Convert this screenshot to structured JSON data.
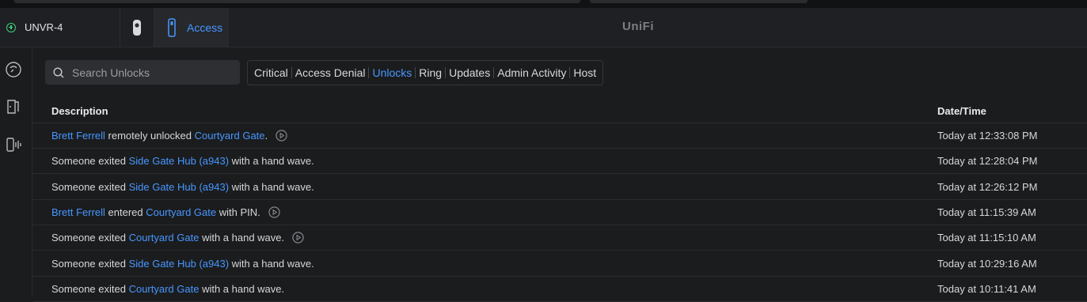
{
  "header": {
    "console_name": "UNVR-4",
    "active_app_label": "Access",
    "brand": "UniFi"
  },
  "search": {
    "placeholder": "Search Unlocks"
  },
  "filters": [
    "Critical",
    "Access Denial",
    "Unlocks",
    "Ring",
    "Updates",
    "Admin Activity",
    "Host"
  ],
  "active_filter": "Unlocks",
  "table": {
    "columns": [
      "Description",
      "Date/Time"
    ],
    "rows": [
      {
        "parts": [
          {
            "t": "Brett Ferrell",
            "link": true
          },
          {
            "t": " remotely unlocked "
          },
          {
            "t": "Courtyard Gate",
            "link": true
          },
          {
            "t": "."
          }
        ],
        "play": true,
        "time": "Today at 12:33:08 PM"
      },
      {
        "parts": [
          {
            "t": "Someone exited "
          },
          {
            "t": "Side Gate Hub (a943)",
            "link": true
          },
          {
            "t": " with a hand wave."
          }
        ],
        "play": false,
        "time": "Today at 12:28:04 PM"
      },
      {
        "parts": [
          {
            "t": "Someone exited "
          },
          {
            "t": "Side Gate Hub (a943)",
            "link": true
          },
          {
            "t": " with a hand wave."
          }
        ],
        "play": false,
        "time": "Today at 12:26:12 PM"
      },
      {
        "parts": [
          {
            "t": "Brett Ferrell",
            "link": true
          },
          {
            "t": " entered "
          },
          {
            "t": "Courtyard Gate",
            "link": true
          },
          {
            "t": " with PIN."
          }
        ],
        "play": true,
        "time": "Today at 11:15:39 AM"
      },
      {
        "parts": [
          {
            "t": "Someone exited "
          },
          {
            "t": "Courtyard Gate",
            "link": true
          },
          {
            "t": " with a hand wave."
          }
        ],
        "play": true,
        "time": "Today at 11:15:10 AM"
      },
      {
        "parts": [
          {
            "t": "Someone exited "
          },
          {
            "t": "Side Gate Hub (a943)",
            "link": true
          },
          {
            "t": " with a hand wave."
          }
        ],
        "play": false,
        "time": "Today at 10:29:16 AM"
      },
      {
        "parts": [
          {
            "t": "Someone exited "
          },
          {
            "t": "Courtyard Gate",
            "link": true
          },
          {
            "t": " with a hand wave."
          }
        ],
        "play": false,
        "time": "Today at 10:11:41 AM"
      }
    ]
  },
  "colors": {
    "accent": "#4797ff",
    "online": "#3ecf7a",
    "background": "#1b1c1e"
  },
  "icons": {
    "console_status": "online-plus-icon",
    "protect": "camera-icon",
    "access": "door-reader-icon",
    "search": "search-icon",
    "play": "play-icon",
    "nav": [
      "dashboard-icon",
      "doors-icon",
      "devices-icon"
    ]
  }
}
